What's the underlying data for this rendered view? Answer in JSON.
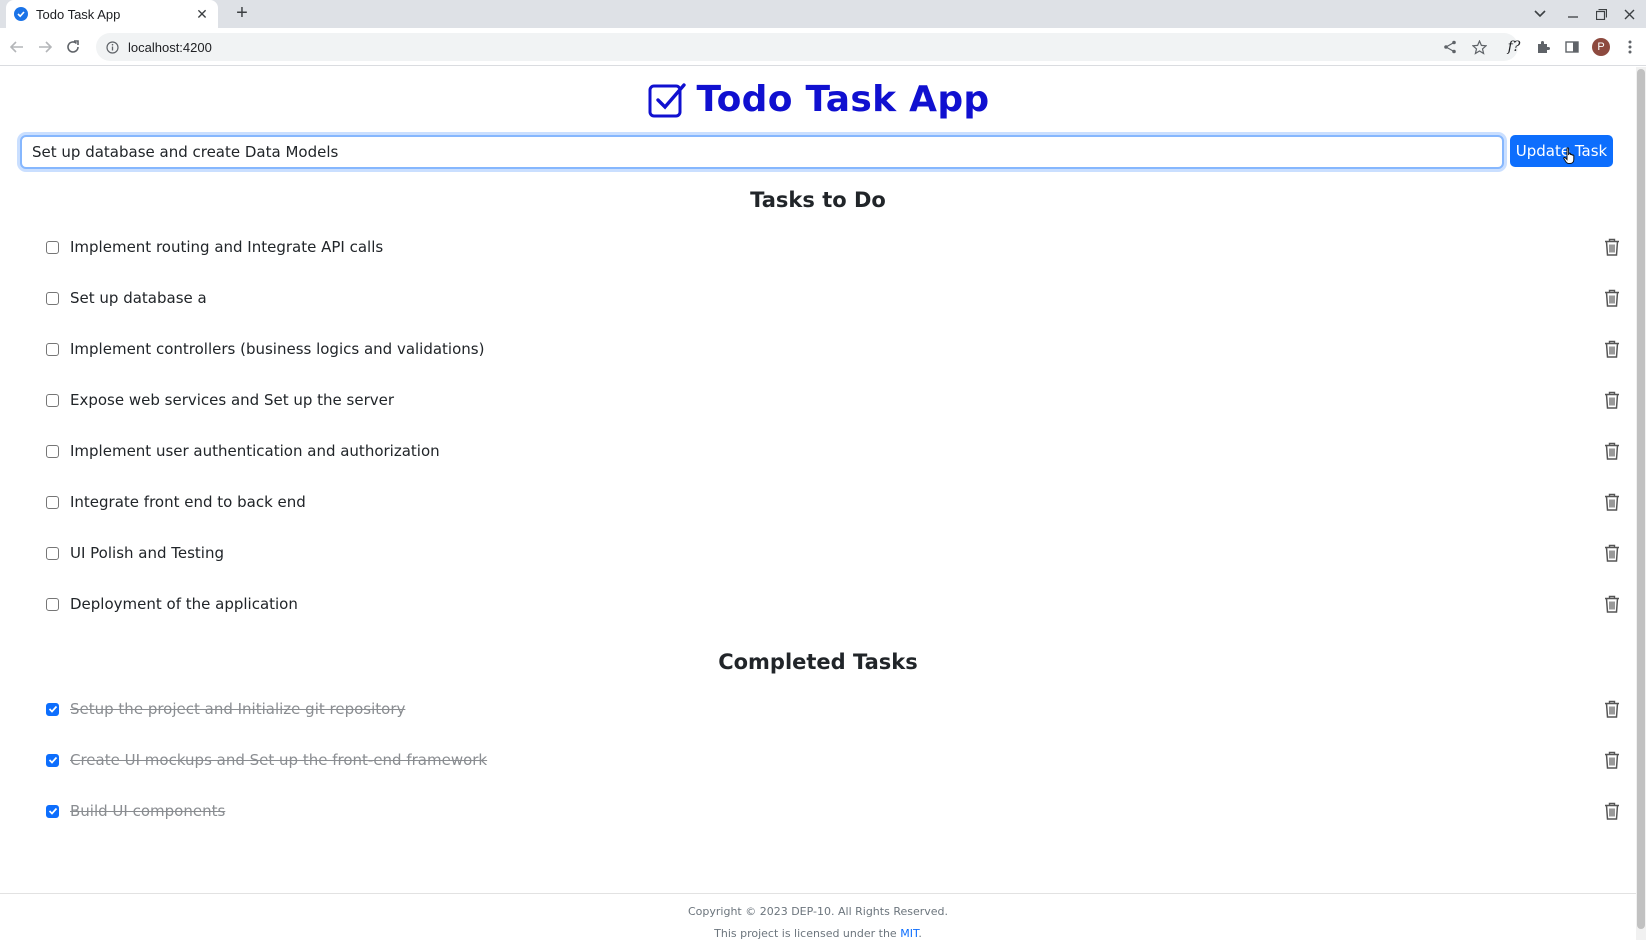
{
  "browser": {
    "tab_title": "Todo Task App",
    "url": "localhost:4200",
    "profile_initial": "P"
  },
  "app": {
    "title": "Todo Task App",
    "input_value": "Set up database and create Data Models",
    "update_button": "Update Task",
    "todo_heading": "Tasks to Do",
    "completed_heading": "Completed Tasks",
    "todo_tasks": [
      "Implement routing and Integrate API calls",
      "Set up database a",
      "Implement controllers (business logics and validations)",
      "Expose web services and Set up the server",
      "Implement user authentication and authorization",
      "Integrate front end to back end",
      "UI Polish and Testing",
      "Deployment of the application"
    ],
    "completed_tasks": [
      "Setup the project and Initialize git repository",
      "Create UI mockups and Set up the front-end framework",
      "Build UI components"
    ]
  },
  "footer": {
    "copyright": "Copyright © 2023 DEP-10. All Rights Reserved.",
    "license_prefix": "This project is licensed under the ",
    "license_link": "MIT",
    "license_suffix": "."
  },
  "colors": {
    "accent": "#0d6efd",
    "title": "#1010d0"
  }
}
